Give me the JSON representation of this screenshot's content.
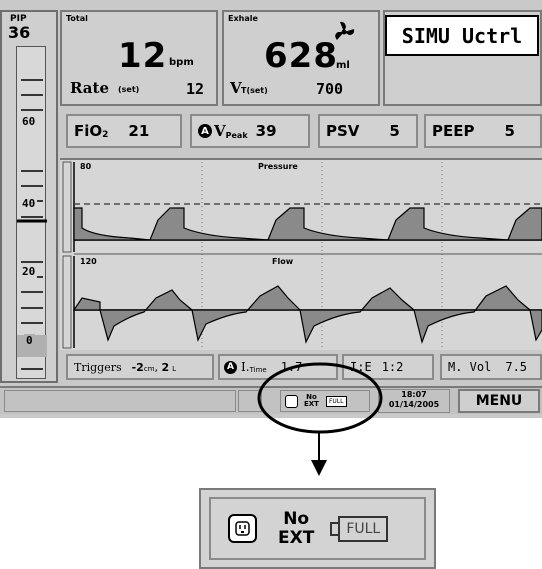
{
  "gauge": {
    "label": "PIP",
    "value": "36",
    "ticks": [
      "60",
      "40",
      "20",
      "0"
    ]
  },
  "total": {
    "label": "Total",
    "value": "12",
    "unit": "bpm",
    "rate_label": "Rate",
    "rate_suffix": "(set)",
    "rate_value": "12"
  },
  "exhale": {
    "label": "Exhale",
    "value": "628",
    "unit": "ml",
    "vt_label": "V",
    "vt_sub": "T(set)",
    "vt_value": "700"
  },
  "mode": {
    "label": "SIMU Uctrl"
  },
  "settings": {
    "fio2_label": "FiO",
    "fio2_sub": "2",
    "fio2_value": "21",
    "vpeak_lock": "A",
    "vpeak_label": "V",
    "vpeak_sub": "Peak",
    "vpeak_value": "39",
    "psv_label": "PSV",
    "psv_value": "5",
    "peep_label": "PEEP",
    "peep_value": "5"
  },
  "waveforms": {
    "pressure_label": "Pressure",
    "pressure_scale": "80",
    "flow_label": "Flow",
    "flow_scale": "120"
  },
  "bottom_row": {
    "triggers_label": "Triggers",
    "triggers_value": "-2",
    "triggers_unit": "cm",
    "triggers_value2": "2",
    "triggers_unit2": "L",
    "itime_lock": "A",
    "itime_label": "I.",
    "itime_sub": "Time",
    "itime_value": "1.7",
    "ie_label": "I:E",
    "ie_value": "1:2",
    "mvol_label": "M. Vol",
    "mvol_value": "7.5"
  },
  "status": {
    "power_text_1": "No",
    "power_text_2": "EXT",
    "battery_text": "FULL",
    "time": "18:07",
    "date": "01/14/2005",
    "menu_label": "MENU"
  },
  "zoom": {
    "power_text_1": "No",
    "power_text_2": "EXT",
    "battery_text": "FULL"
  },
  "colors": {
    "screen_bg": "#c9c9c9",
    "panel_bg": "#cfcfcf",
    "wave_fill": "#8a8a8a",
    "highlight": "#ffffff"
  }
}
